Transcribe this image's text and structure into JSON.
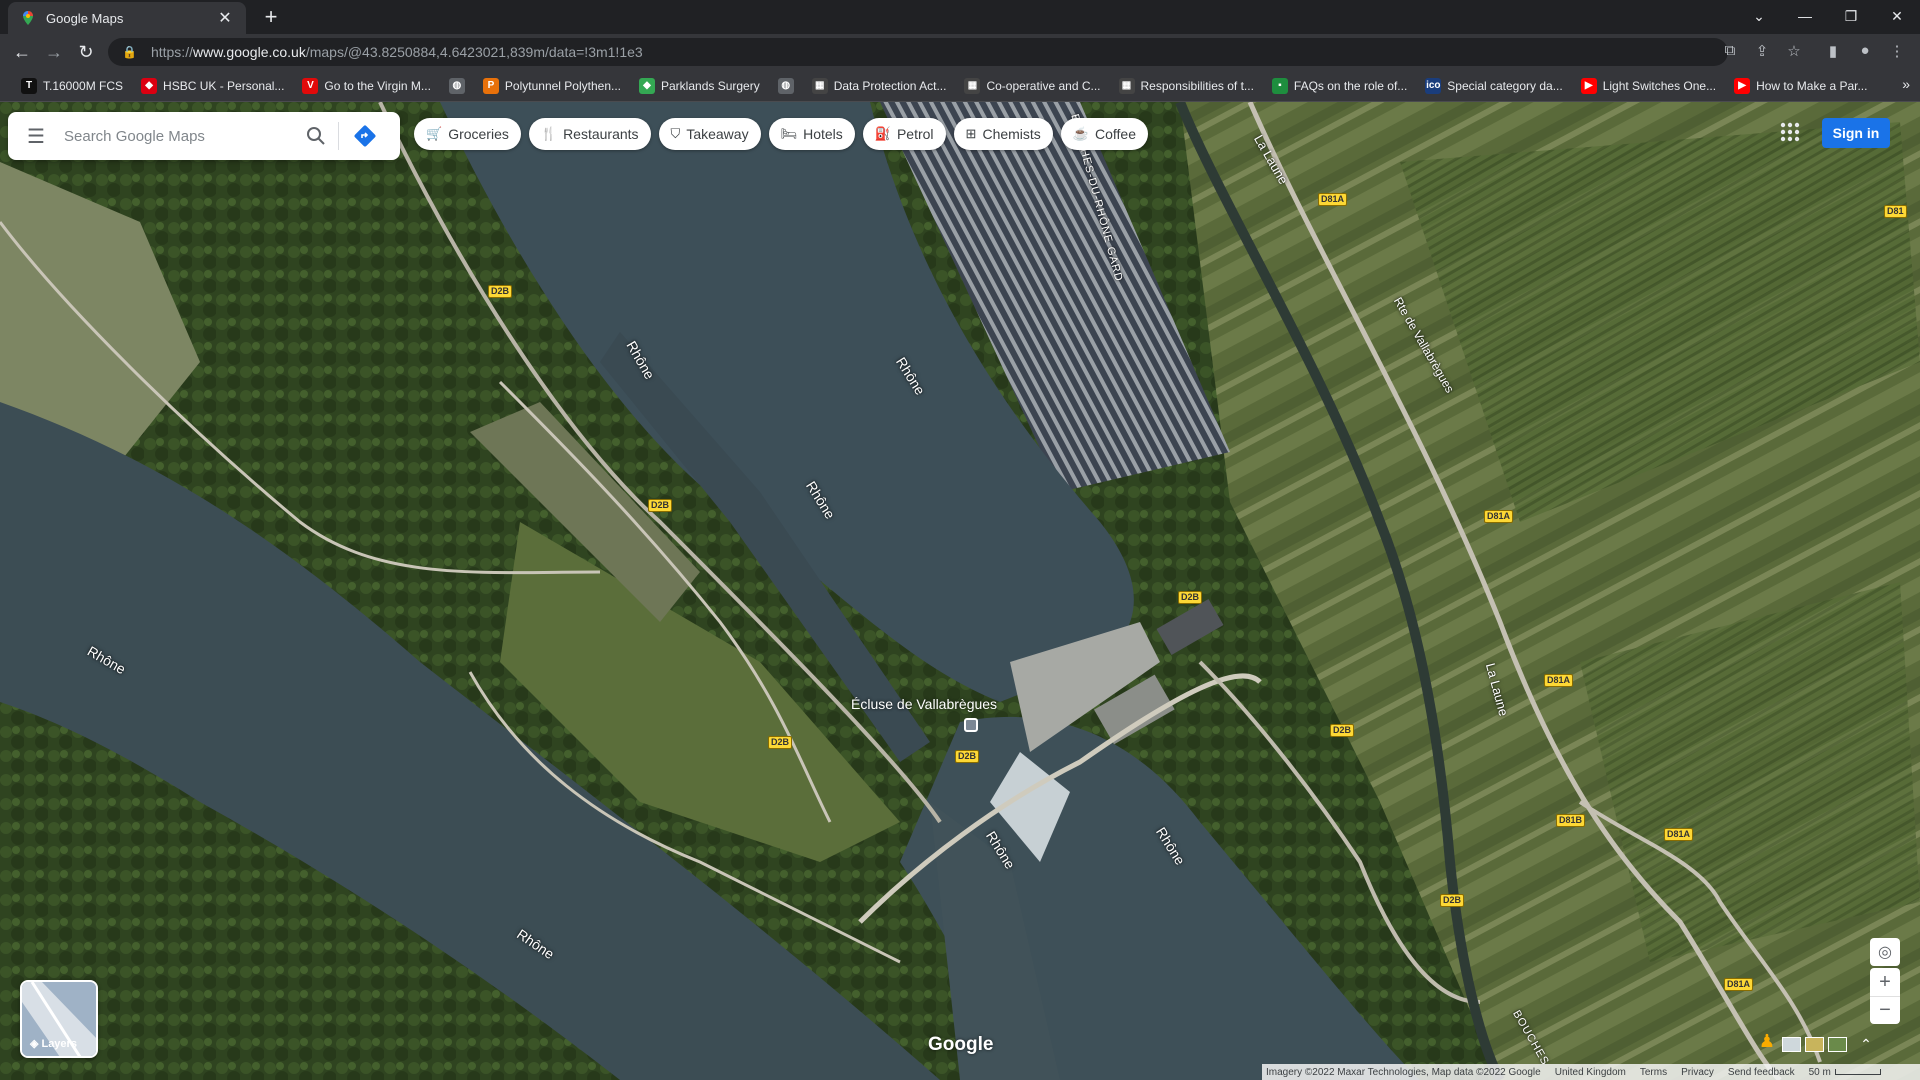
{
  "browser": {
    "tab_title": "Google Maps",
    "url_prefix": "https://",
    "url_host": "www.google.co.uk",
    "url_path": "/maps/@43.8250884,4.6423021,839m/data=!3m1!1e3",
    "bookmarks": [
      {
        "label": "T.16000M FCS",
        "color": "#111111",
        "glyph": "T"
      },
      {
        "label": "HSBC UK - Personal...",
        "color": "#db0011",
        "glyph": "◆"
      },
      {
        "label": "Go to the Virgin M...",
        "color": "#e10a0a",
        "glyph": "V"
      },
      {
        "label": "",
        "color": "#5f6368",
        "glyph": "◍"
      },
      {
        "label": "Polytunnel Polythen...",
        "color": "#e8710a",
        "glyph": "P"
      },
      {
        "label": "Parklands Surgery",
        "color": "#34a853",
        "glyph": "◆"
      },
      {
        "label": "",
        "color": "#5f6368",
        "glyph": "◍"
      },
      {
        "label": "Data Protection Act...",
        "color": "#444444",
        "glyph": "▦"
      },
      {
        "label": "Co-operative and C...",
        "color": "#444444",
        "glyph": "▦"
      },
      {
        "label": "Responsibilities of t...",
        "color": "#444444",
        "glyph": "▦"
      },
      {
        "label": "FAQs on the role of...",
        "color": "#1e8e3e",
        "glyph": "▪"
      },
      {
        "label": "Special category da...",
        "color": "#1a3d7c",
        "glyph": "ico"
      },
      {
        "label": "Light Switches One...",
        "color": "#ff0000",
        "glyph": "▶"
      },
      {
        "label": "How to Make a Par...",
        "color": "#ff0000",
        "glyph": "▶"
      }
    ]
  },
  "maps": {
    "search_placeholder": "Search Google Maps",
    "chips": [
      {
        "label": "Groceries",
        "icon": "🛒"
      },
      {
        "label": "Restaurants",
        "icon": "🍴"
      },
      {
        "label": "Takeaway",
        "icon": "⛉"
      },
      {
        "label": "Hotels",
        "icon": "🛏"
      },
      {
        "label": "Petrol",
        "icon": "⛽"
      },
      {
        "label": "Chemists",
        "icon": "⊞"
      },
      {
        "label": "Coffee",
        "icon": "☕"
      }
    ],
    "sign_in": "Sign in",
    "layers_label": "Layers",
    "logo": "Google",
    "attribution": {
      "imagery": "Imagery ©2022 Maxar Technologies, Map data ©2022 Google",
      "region": "United Kingdom",
      "terms": "Terms",
      "privacy": "Privacy",
      "feedback": "Send feedback",
      "scale": "50 m"
    },
    "labels": {
      "rhone": "Rhône",
      "la_laune": "La Laune",
      "route_vallabregues": "Rte de Vallabrègues",
      "bouches_gard": "BOUCHES-DU-RHÔNE GARD",
      "bouches": "BOUCHES",
      "ecluse": "Écluse de Vallabrègues"
    },
    "roads": {
      "d2b": "D2B",
      "d81a": "D81A",
      "d81": "D81",
      "d81b": "D81B"
    }
  }
}
